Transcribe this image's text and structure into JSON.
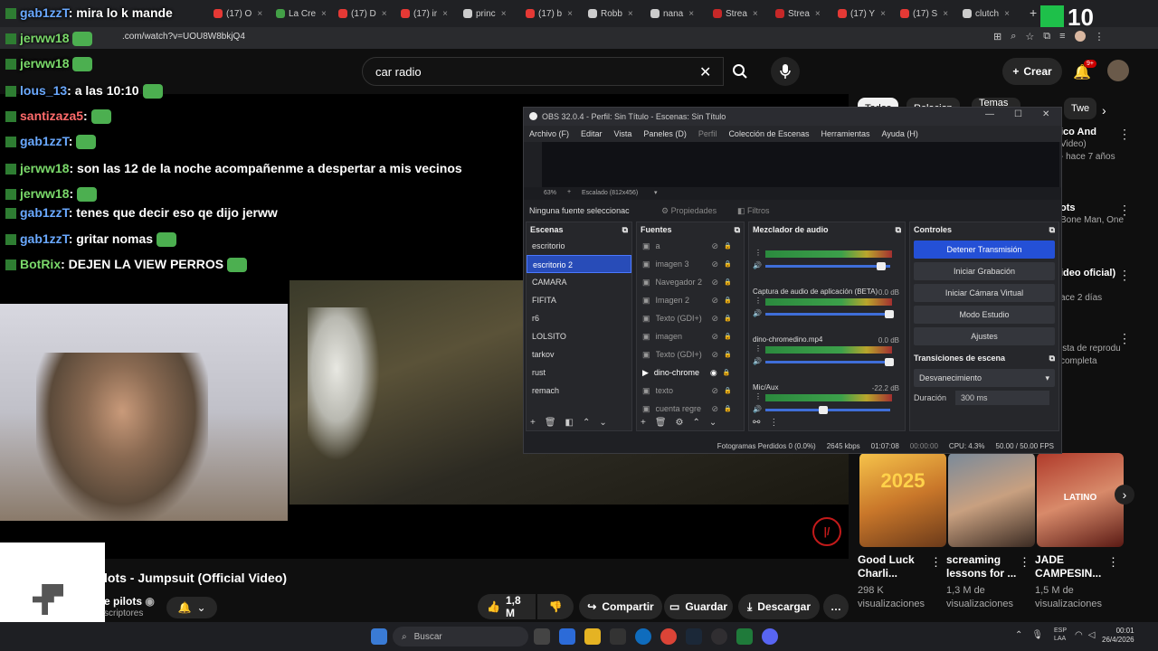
{
  "browser": {
    "tabs": [
      {
        "label": "(17) O",
        "color": "#e53935"
      },
      {
        "label": "La Cre",
        "color": "#43a047"
      },
      {
        "label": "(17) D",
        "color": "#e53935"
      },
      {
        "label": "(17) ir",
        "color": "#e53935"
      },
      {
        "label": "princ",
        "color": "#ccc"
      },
      {
        "label": "(17) b",
        "color": "#e53935"
      },
      {
        "label": "Robb",
        "color": "#ccc"
      },
      {
        "label": "nana",
        "color": "#ccc"
      },
      {
        "label": "Strea",
        "color": "#c62828"
      },
      {
        "label": "Strea",
        "color": "#c62828"
      },
      {
        "label": "(17) Y",
        "color": "#e53935"
      },
      {
        "label": "(17) S",
        "color": "#e53935"
      },
      {
        "label": "clutch",
        "color": "#ccc"
      }
    ],
    "url": ".com/watch?v=UOU8W8bkjQ4"
  },
  "youtube": {
    "search_value": "car radio",
    "create_label": "Crear",
    "notif_badge": "9+",
    "video_title": "lots - Jumpsuit (Official Video)",
    "channel": "e pilots",
    "subs": "scriptores",
    "like_count": "1,8 M",
    "share_label": "Compartir",
    "save_label": "Guardar",
    "download_label": "Descargar",
    "logo_text": "|/",
    "chips": [
      "Todos",
      "Relacion",
      "Temas escritos",
      "Twe"
    ]
  },
  "sidebar": {
    "rows": [
      {
        "title": "ico And",
        "sub": "Video)",
        "meta": "- hace 7 años"
      },
      {
        "title": "ots",
        "sub": "Bone Man, One",
        "meta": ""
      },
      {
        "title": "ideo oficial)",
        "sub": "",
        "meta": "ace 2 días"
      },
      {
        "title": "",
        "sub": "ista de reprodu",
        "meta": "completa"
      }
    ],
    "cards": [
      {
        "title": "Good Luck Charli...",
        "views": "298 K",
        "views2": "visualizaciones",
        "thumb_text": "2025"
      },
      {
        "title": "screaming lessons for ...",
        "views": "1,3 M de",
        "views2": "visualizaciones",
        "thumb_text": ""
      },
      {
        "title": "JADE CAMPESIN...",
        "views": "1,5 M de",
        "views2": "visualizaciones",
        "thumb_text": "LATINO"
      }
    ]
  },
  "chat": [
    {
      "user": "gab1zzT",
      "msg": ": mira lo k mande",
      "cls": "u"
    },
    {
      "user": "jerww18",
      "msg": "",
      "cls": "u g"
    },
    {
      "user": "jerww18",
      "msg": "",
      "cls": "u g"
    },
    {
      "user": "lous_13",
      "msg": ": a las 10:10",
      "cls": "u"
    },
    {
      "user": "santizaza5",
      "msg": ":",
      "cls": "u r"
    },
    {
      "user": "gab1zzT",
      "msg": ":",
      "cls": "u"
    },
    {
      "user": "jerww18",
      "msg": ": son las 12 de la noche acompañenme a despertar a mis vecinos",
      "cls": "u g"
    },
    {
      "user": "jerww18",
      "msg": ":",
      "cls": "u g"
    },
    {
      "user": "gab1zzT",
      "msg": ": tenes que decir eso qe dijo jerww",
      "cls": "u"
    },
    {
      "user": "gab1zzT",
      "msg": ": gritar nomas",
      "cls": "u"
    },
    {
      "user": "BotRix",
      "msg": ": DEJEN LA VIEW PERROS",
      "cls": "u g"
    }
  ],
  "obs": {
    "title": "OBS 32.0.4 - Perfil: Sin Título - Escenas: Sin Título",
    "menu": [
      "Archivo (F)",
      "Editar",
      "Vista",
      "Paneles (D)",
      "Perfil",
      "Colección de Escenas",
      "Herramientas",
      "Ayuda (H)"
    ],
    "zoom_info": "63%",
    "scale_info": "Escalado (812x456)",
    "no_source": "Ninguna fuente seleccionac",
    "props_label": "Propiedades",
    "filters_label": "Filtros",
    "scenes_header": "Escenas",
    "scenes": [
      "escritorio",
      "escritorio 2",
      "CAMARA",
      "FIFITA",
      "r6",
      "LOLSITO",
      "tarkov",
      "rust",
      "remach"
    ],
    "selected_scene": 1,
    "sources_header": "Fuentes",
    "sources": [
      "a",
      "imagen 3",
      "Navegador 2",
      "Imagen 2",
      "Texto (GDI+)",
      "imagen",
      "Texto (GDI+)",
      "dino-chrome",
      "texto",
      "cuenta regre"
    ],
    "active_source": 7,
    "mixer_header": "Mezclador de audio",
    "mixer": [
      {
        "name": "",
        "db": "",
        "level": 0.93
      },
      {
        "name": "Captura de audio de aplicación (BETA)",
        "db": "0.0 dB",
        "level": 1.0
      },
      {
        "name": "dino-chromedino.mp4",
        "db": "0.0 dB",
        "level": 1.0
      },
      {
        "name": "Mic/Aux",
        "db": "-22.2 dB",
        "level": 0.45
      }
    ],
    "controls_header": "Controles",
    "controls": [
      "Detener Transmisión",
      "Iniciar Grabación",
      "Iniciar Cámara Virtual",
      "Modo Estudio",
      "Ajustes"
    ],
    "transitions_header": "Transiciones de escena",
    "transition": "Desvanecimiento",
    "duration_label": "Duración",
    "duration_value": "300 ms",
    "status": [
      "Fotogramas Perdidos 0 (0.0%)",
      "2645 kbps",
      "01:07:08",
      "00:00:00",
      "CPU: 4.3%",
      "50.00 / 50.00 FPS"
    ]
  },
  "taskbar": {
    "search_placeholder": "Buscar",
    "lang": "ESP LAA",
    "time": "00:01",
    "date": "26/4/2026"
  },
  "overlay": {
    "score": "10"
  }
}
